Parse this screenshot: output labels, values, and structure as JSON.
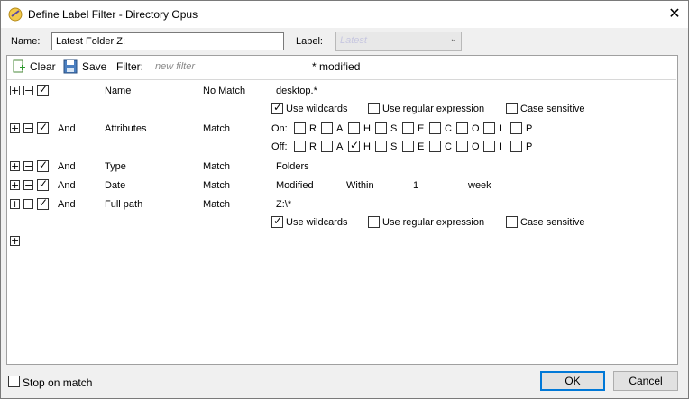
{
  "window": {
    "title": "Define Label Filter - Directory Opus"
  },
  "name_field": {
    "label": "Name:",
    "value": "Latest Folder Z:"
  },
  "label_field": {
    "label": "Label:",
    "value": "Latest"
  },
  "toolbar": {
    "clear_label": "Clear",
    "save_label": "Save",
    "filter_label": "Filter:",
    "filter_placeholder": "new filter",
    "modified_text": "* modified"
  },
  "rows": [
    {
      "connector": "",
      "field": "Name",
      "match": "No Match",
      "value": "desktop.*",
      "options": {
        "wildcards": "Use wildcards",
        "wildcards_checked": true,
        "regex": "Use regular expression",
        "regex_checked": false,
        "case": "Case sensitive",
        "case_checked": false
      }
    },
    {
      "connector": "And",
      "field": "Attributes",
      "match": "Match",
      "on_label": "On:",
      "off_label": "Off:",
      "attrs": [
        "R",
        "A",
        "H",
        "S",
        "E",
        "C",
        "O",
        "I",
        "P"
      ],
      "on_checked": [
        false,
        false,
        false,
        false,
        false,
        false,
        false,
        false,
        false
      ],
      "off_checked": [
        false,
        false,
        true,
        false,
        false,
        false,
        false,
        false,
        false
      ]
    },
    {
      "connector": "And",
      "field": "Type",
      "match": "Match",
      "value": "Folders"
    },
    {
      "connector": "And",
      "field": "Date",
      "match": "Match",
      "value": "Modified",
      "within": "Within",
      "amount": "1",
      "unit": "week"
    },
    {
      "connector": "And",
      "field": "Full path",
      "match": "Match",
      "value": "Z:\\*",
      "options": {
        "wildcards": "Use wildcards",
        "wildcards_checked": true,
        "regex": "Use regular expression",
        "regex_checked": false,
        "case": "Case sensitive",
        "case_checked": false
      }
    }
  ],
  "footer": {
    "stop_on_match": "Stop on match",
    "stop_on_match_checked": false,
    "ok_label": "OK",
    "cancel_label": "Cancel"
  },
  "icons": [
    "app-icon",
    "close-icon",
    "clear-icon",
    "save-icon",
    "expand-icon",
    "collapse-icon",
    "enabled-checkbox"
  ]
}
